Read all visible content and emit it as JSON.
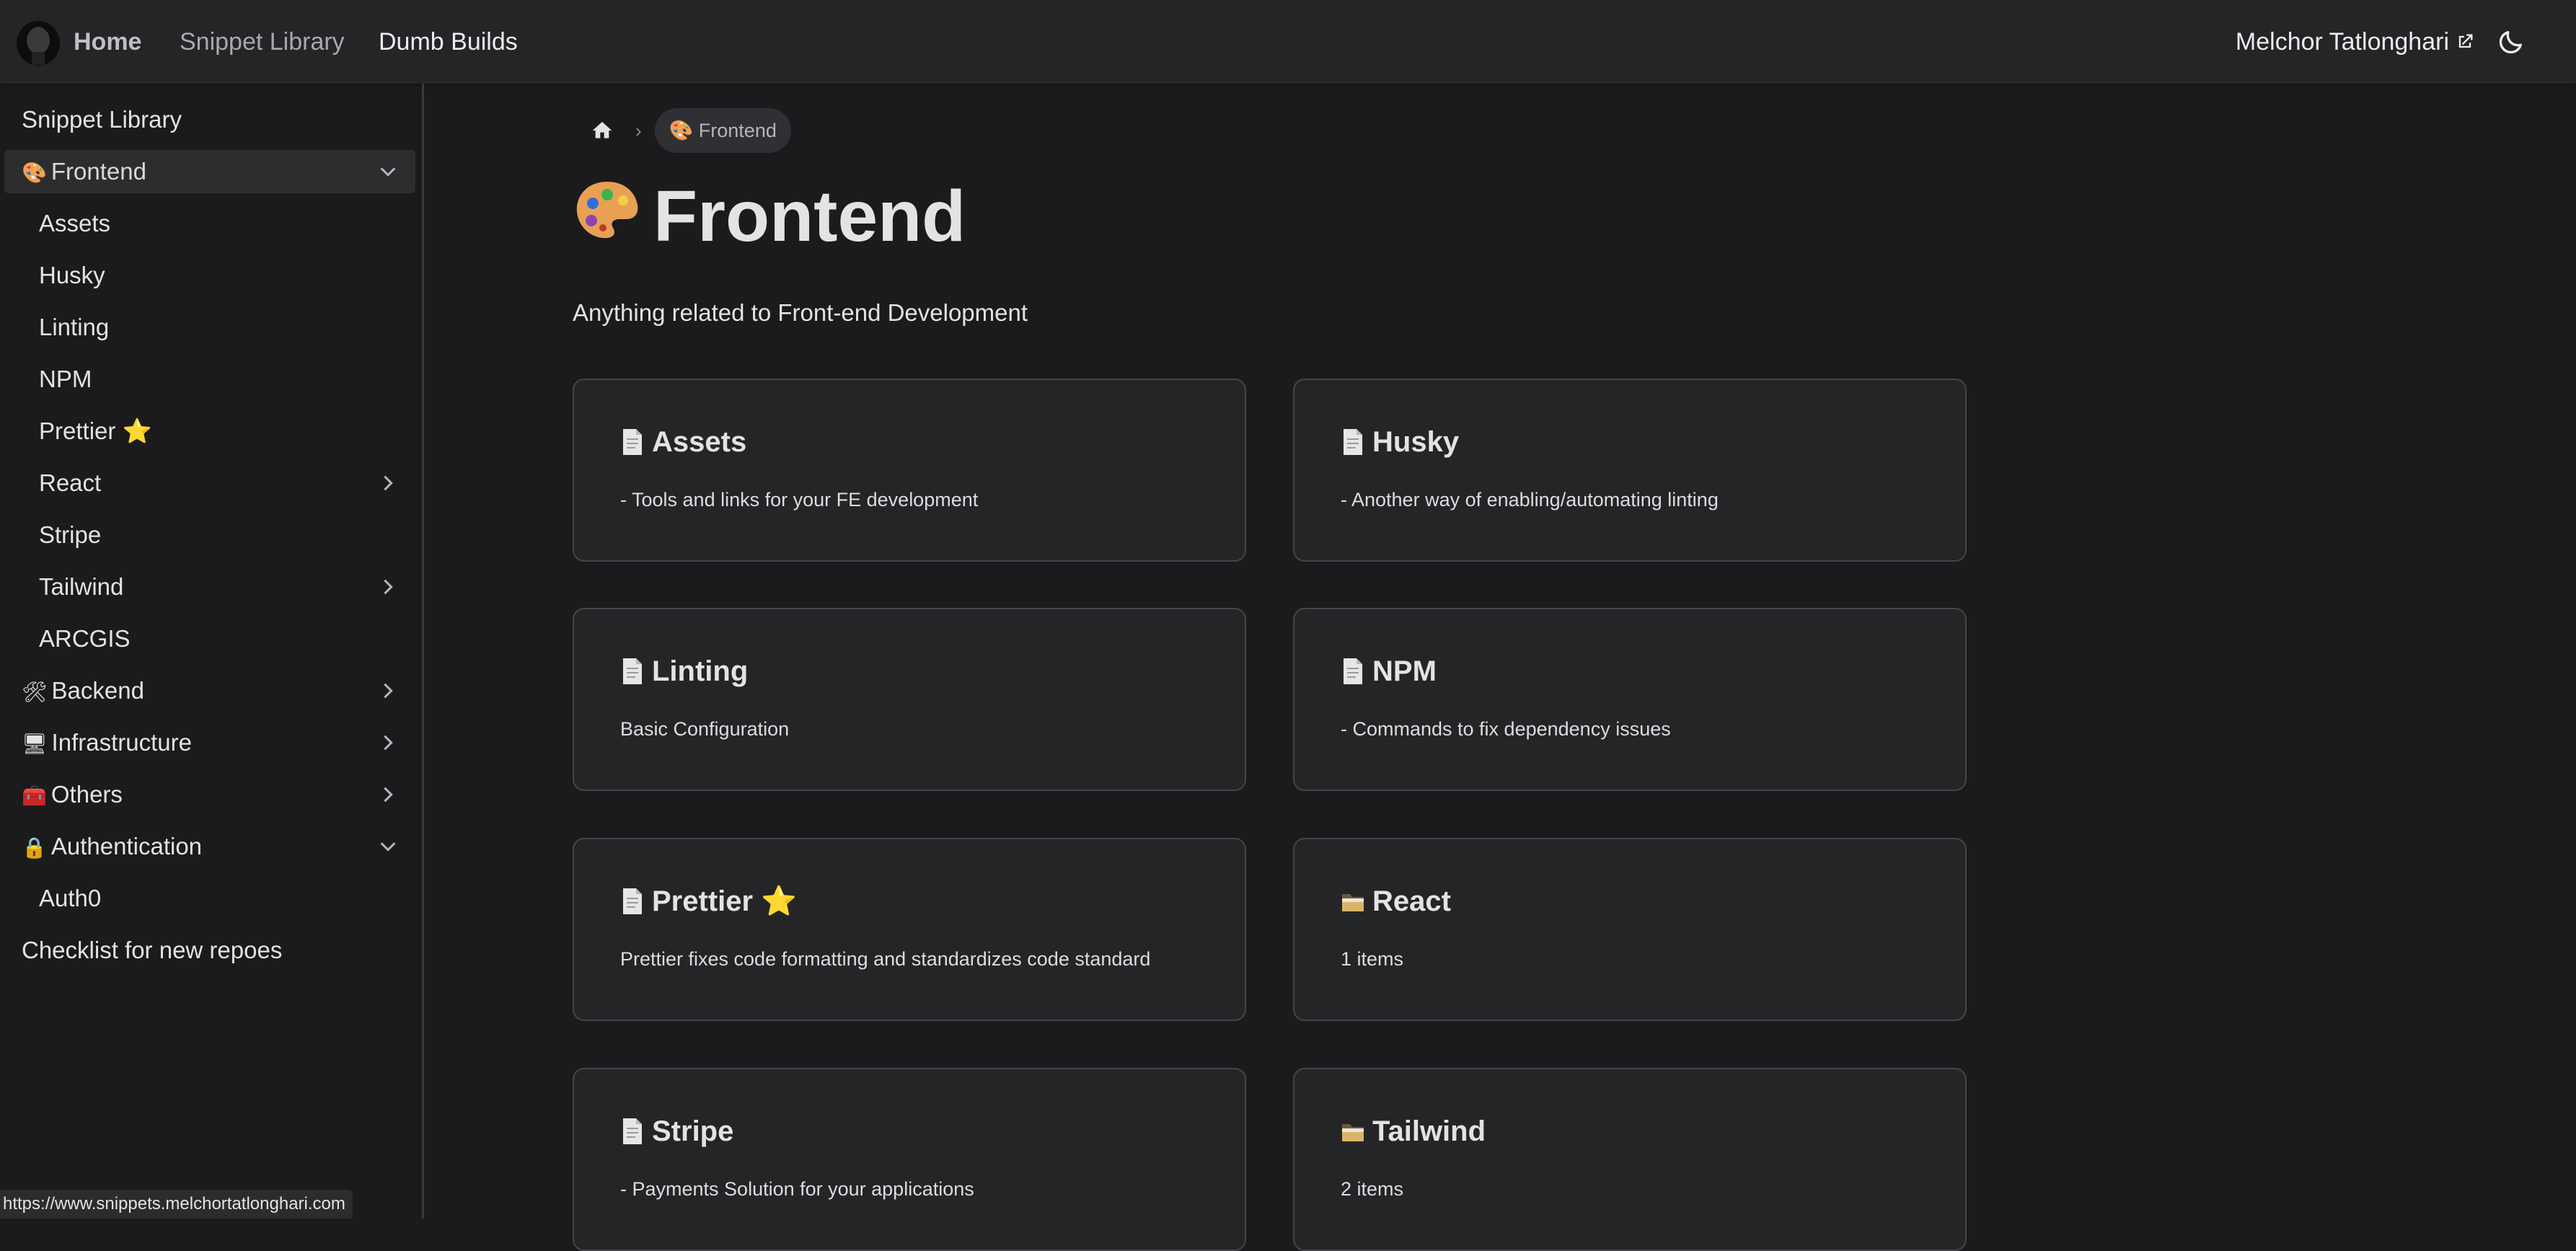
{
  "navbar": {
    "home": "Home",
    "snippet_library": "Snippet Library",
    "dumb_builds": "Dumb Builds",
    "author": "Melchor Tatlonghari"
  },
  "sidebar": {
    "root": "Snippet Library",
    "frontend": {
      "emoji": "🎨",
      "label": "Frontend"
    },
    "frontend_items": [
      "Assets",
      "Husky",
      "Linting",
      "NPM",
      "Prettier ⭐",
      "React",
      "Stripe",
      "Tailwind",
      "ARCGIS"
    ],
    "backend": {
      "emoji": "🛠",
      "label": "Backend"
    },
    "infrastructure": {
      "emoji": "🖥",
      "label": "Infrastructure"
    },
    "others": {
      "emoji": "🧰",
      "label": "Others"
    },
    "authentication": {
      "emoji": "🔒",
      "label": "Authentication"
    },
    "auth_items": [
      "Auth0"
    ],
    "checklist": "Checklist for new repoes"
  },
  "breadcrumb": {
    "current": "🎨 Frontend"
  },
  "page": {
    "title_emoji": "🎨",
    "title": "Frontend",
    "description": "Anything related to Front-end Development"
  },
  "cards": [
    {
      "title": "Assets",
      "desc": "- Tools and links for your FE development",
      "kind": "doc"
    },
    {
      "title": "Husky",
      "desc": "- Another way of enabling/automating linting",
      "kind": "doc"
    },
    {
      "title": "Linting",
      "desc": "Basic Configuration",
      "kind": "doc"
    },
    {
      "title": "NPM",
      "desc": "- Commands to fix dependency issues",
      "kind": "doc"
    },
    {
      "title": "Prettier ⭐",
      "desc": "Prettier fixes code formatting and standardizes code standard",
      "kind": "doc"
    },
    {
      "title": "React",
      "desc": "1 items",
      "kind": "folder"
    },
    {
      "title": "Stripe",
      "desc": "- Payments Solution for your applications",
      "kind": "doc"
    },
    {
      "title": "Tailwind",
      "desc": "2 items",
      "kind": "folder"
    }
  ],
  "status_url": "https://www.snippets.melchortatlonghari.com"
}
